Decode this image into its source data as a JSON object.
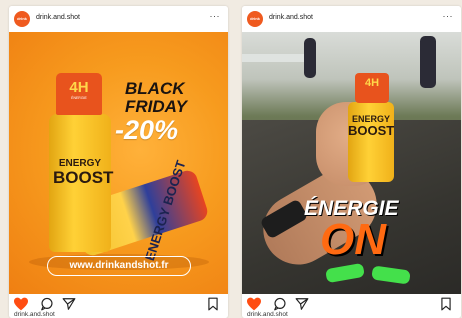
{
  "posts": [
    {
      "username": "drink.and.shot",
      "avatar_text": "drink and shot",
      "more": "···",
      "bottle": {
        "cap": "4H",
        "cap_sub": "ÉNERGIE",
        "label_top": "ENERGY",
        "label_big": "BOOST"
      },
      "bottle2_text": "ENERGY BOOST",
      "promo": {
        "line1": "BLACK",
        "line2": "FRIDAY",
        "line3": "-20%"
      },
      "url": "www.drinkandshot.fr",
      "footer_username": "drink.and.shot"
    },
    {
      "username": "drink.and.shot",
      "avatar_text": "drink and shot",
      "more": "···",
      "bottle": {
        "cap": "4H",
        "label_top": "ENERGY",
        "label_big": "BOOST"
      },
      "headline": {
        "line1": "ÉNERGIE",
        "line2": "ON"
      },
      "footer_username": "drink.and.shot"
    }
  ],
  "colors": {
    "like_active": "#ff4d12",
    "brand_orange": "#ef5a1f",
    "headline_orange": "#ff6a12",
    "background": "#f1ebe2"
  },
  "icons": [
    "heart-icon",
    "comment-icon",
    "share-icon",
    "bookmark-icon",
    "more-icon"
  ]
}
